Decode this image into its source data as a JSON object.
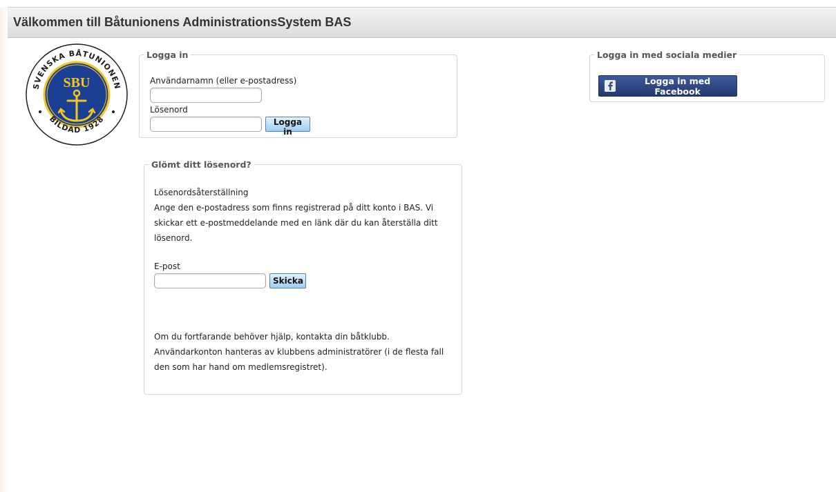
{
  "header": {
    "title": "Välkommen till Båtunionens AdministrationsSystem BAS"
  },
  "logo": {
    "ring_text_top": "SVENSKA BÅTUNIONEN",
    "ring_text_bottom": "BILDAD 1928",
    "center_text": "SBU",
    "colors": {
      "ring": "#1b3f93",
      "gold": "#f2c81c",
      "navy": "#1b3f93"
    }
  },
  "login": {
    "legend": "Logga in",
    "username_label": "Användarnamn (eller e-postadress)",
    "username_value": "",
    "password_label": "Lösenord",
    "password_value": "",
    "submit_label": "Logga in"
  },
  "forgot": {
    "legend": "Glömt ditt lösenord?",
    "heading": "Lösenordsåterställning",
    "description": "Ange den e-postadress som finns registrerad på ditt konto i BAS. Vi skickar ett e-postmeddelande med en länk där du kan återställa ditt lösenord.",
    "email_label": "E-post",
    "email_value": "",
    "submit_label": "Skicka",
    "help_text": "Om du fortfarande behöver hjälp, kontakta din båtklubb. Användarkonton hanteras av klubbens administratörer (i de flesta fall den som har hand om medlemsregistret)."
  },
  "social": {
    "legend": "Logga in med sociala medier",
    "facebook_label": "Logga in med Facebook",
    "facebook_icon": "facebook-icon",
    "facebook_color": "#2d4a8a"
  }
}
